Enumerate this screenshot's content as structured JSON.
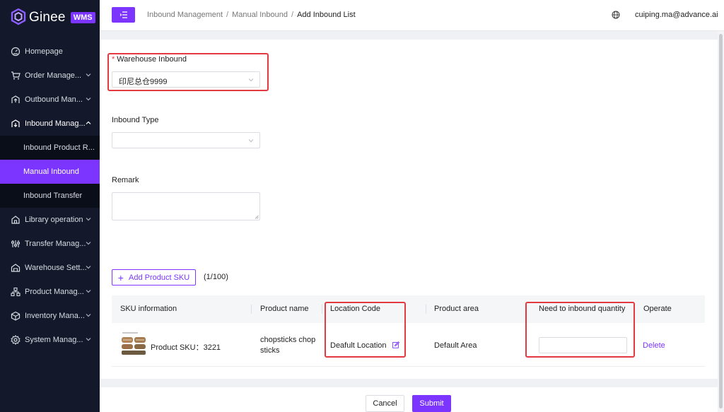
{
  "brand": {
    "name": "Ginee",
    "badge": "WMS",
    "accent": "#7b35ff"
  },
  "sidebar": {
    "items": [
      {
        "label": "Homepage",
        "icon": "dashboard-icon"
      },
      {
        "label": "Order Manage...",
        "icon": "cart-icon"
      },
      {
        "label": "Outbound Man...",
        "icon": "outbound-icon"
      },
      {
        "label": "Inbound Manag...",
        "icon": "inbound-icon",
        "expanded": true
      },
      {
        "label": "Library operation",
        "icon": "library-icon"
      },
      {
        "label": "Transfer Manag...",
        "icon": "transfer-icon"
      },
      {
        "label": "Warehouse Sett...",
        "icon": "warehouse-icon"
      },
      {
        "label": "Product Manag...",
        "icon": "product-icon"
      },
      {
        "label": "Inventory Mana...",
        "icon": "inventory-icon"
      },
      {
        "label": "System Manag...",
        "icon": "gear-icon"
      }
    ],
    "subitems": [
      {
        "label": "Inbound Product R..."
      },
      {
        "label": "Manual Inbound",
        "active": true
      },
      {
        "label": "Inbound Transfer"
      }
    ]
  },
  "header": {
    "breadcrumb": [
      "Inbound Management",
      "Manual Inbound",
      "Add Inbound List"
    ],
    "user": "cuiping.ma@advance.ai"
  },
  "form": {
    "warehouse": {
      "label": "Warehouse Inbound",
      "value": "印尼总仓9999"
    },
    "type": {
      "label": "Inbound Type",
      "value": ""
    },
    "remark": {
      "label": "Remark",
      "value": ""
    }
  },
  "sku": {
    "add_label": "Add Product SKU",
    "count": "(1/100)",
    "columns": [
      "SKU information",
      "Product name",
      "Location Code",
      "Product area",
      "Need to inbound quantity",
      "Operate"
    ],
    "rows": [
      {
        "sku": "Product SKU：3221",
        "name_line1": "chopsticks chop",
        "name_line2": "sticks",
        "location": "Deafult Location",
        "area": "Default Area",
        "quantity": "",
        "operate": "Delete"
      }
    ]
  },
  "footer": {
    "cancel": "Cancel",
    "submit": "Submit"
  }
}
